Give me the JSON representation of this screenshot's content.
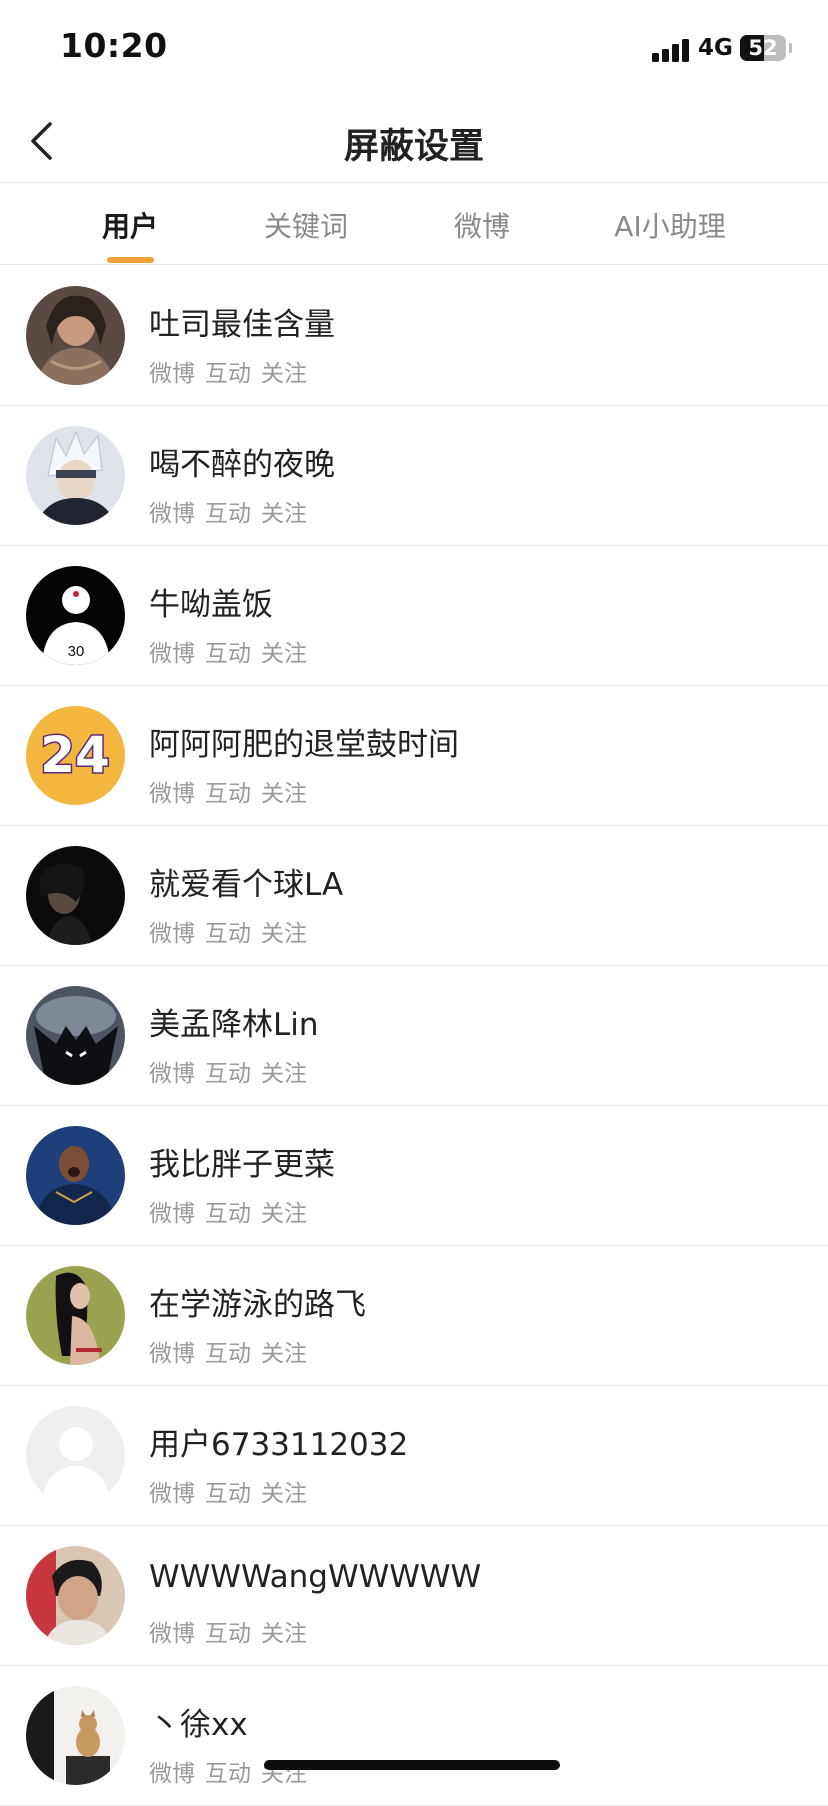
{
  "status_bar": {
    "time": "10:20",
    "network": "4G",
    "battery": "52",
    "battery_level": 0.52
  },
  "nav": {
    "title": "屏蔽设置"
  },
  "tabs": [
    {
      "label": "用户",
      "active": true
    },
    {
      "label": "关键词",
      "active": false
    },
    {
      "label": "微博",
      "active": false
    },
    {
      "label": "AI小助理",
      "active": false
    }
  ],
  "accent_color": "#f0a13c",
  "users": [
    {
      "name": "吐司最佳含量",
      "tags": [
        "微博",
        "互动",
        "关注"
      ],
      "avatar_icon": "photo-woman-avatar"
    },
    {
      "name": "喝不醉的夜晚",
      "tags": [
        "微博",
        "互动",
        "关注"
      ],
      "avatar_icon": "anime-character-avatar"
    },
    {
      "name": "牛呦盖饭",
      "tags": [
        "微博",
        "互动",
        "关注"
      ],
      "avatar_icon": "silhouette-number-avatar",
      "avatar_text": "30"
    },
    {
      "name": "阿阿阿肥的退堂鼓时间",
      "tags": [
        "微博",
        "互动",
        "关注"
      ],
      "avatar_icon": "number-24-avatar",
      "avatar_text": "24"
    },
    {
      "name": "就爱看个球LA",
      "tags": [
        "微博",
        "互动",
        "关注"
      ],
      "avatar_icon": "dark-portrait-avatar"
    },
    {
      "name": "美孟降林Lin",
      "tags": [
        "微博",
        "互动",
        "关注"
      ],
      "avatar_icon": "dark-character-avatar"
    },
    {
      "name": "我比胖子更菜",
      "tags": [
        "微博",
        "互动",
        "关注"
      ],
      "avatar_icon": "football-player-avatar"
    },
    {
      "name": "在学游泳的路飞",
      "tags": [
        "微博",
        "互动",
        "关注"
      ],
      "avatar_icon": "photo-woman-avatar"
    },
    {
      "name": "用户6733112032",
      "tags": [
        "微博",
        "互动",
        "关注"
      ],
      "avatar_icon": "default-user-avatar"
    },
    {
      "name": "WWWWangWWWWW",
      "tags": [
        "微博",
        "互动",
        "关注"
      ],
      "avatar_icon": "photo-person-avatar"
    },
    {
      "name": "丶徐xx",
      "tags": [
        "微博",
        "互动",
        "关注"
      ],
      "avatar_icon": "cat-photo-avatar"
    }
  ]
}
